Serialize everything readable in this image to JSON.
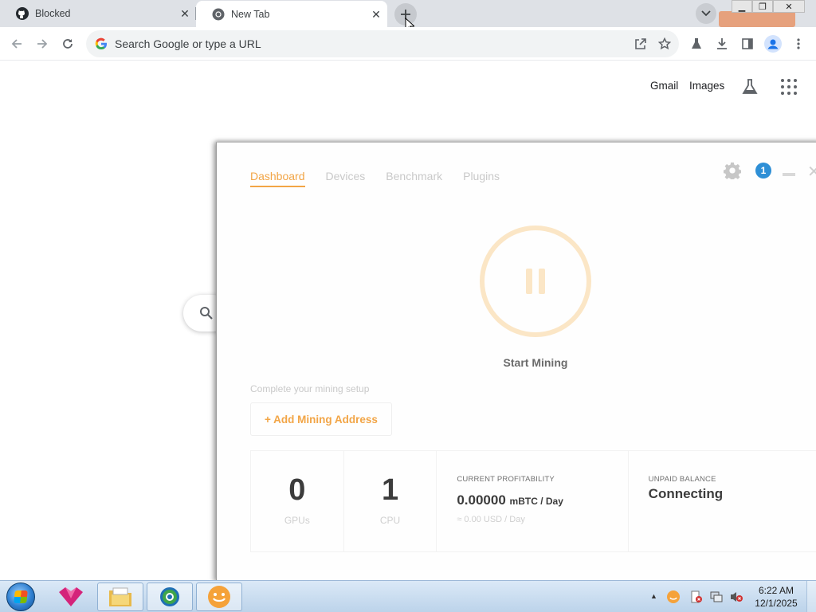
{
  "browser": {
    "tabs": [
      {
        "title": "Blocked",
        "icon": "github-icon"
      },
      {
        "title": "New Tab",
        "icon": "chrome-icon"
      }
    ],
    "omnibox": {
      "placeholder": "Search Google or type a URL"
    }
  },
  "ntp": {
    "gmail": "Gmail",
    "images": "Images"
  },
  "miner": {
    "nav": [
      "Dashboard",
      "Devices",
      "Benchmark",
      "Plugins"
    ],
    "active_tab": "Dashboard",
    "notification_count": "1",
    "start_label": "Start Mining",
    "setup_text": "Complete your mining setup",
    "add_address": "+ Add Mining Address",
    "gpus": {
      "value": "0",
      "label": "GPUs"
    },
    "cpu": {
      "value": "1",
      "label": "CPU"
    },
    "profitability": {
      "caption": "CURRENT PROFITABILITY",
      "value": "0.00000",
      "unit": "mBTC / Day",
      "usd": "≈ 0.00 USD / Day"
    },
    "balance": {
      "caption": "UNPAID BALANCE",
      "value": "Connecting"
    },
    "colors": {
      "accent": "#f2a546",
      "badge": "#2e8fd6"
    }
  },
  "taskbar": {
    "time": "6:22 AM",
    "date": "12/1/2025"
  }
}
